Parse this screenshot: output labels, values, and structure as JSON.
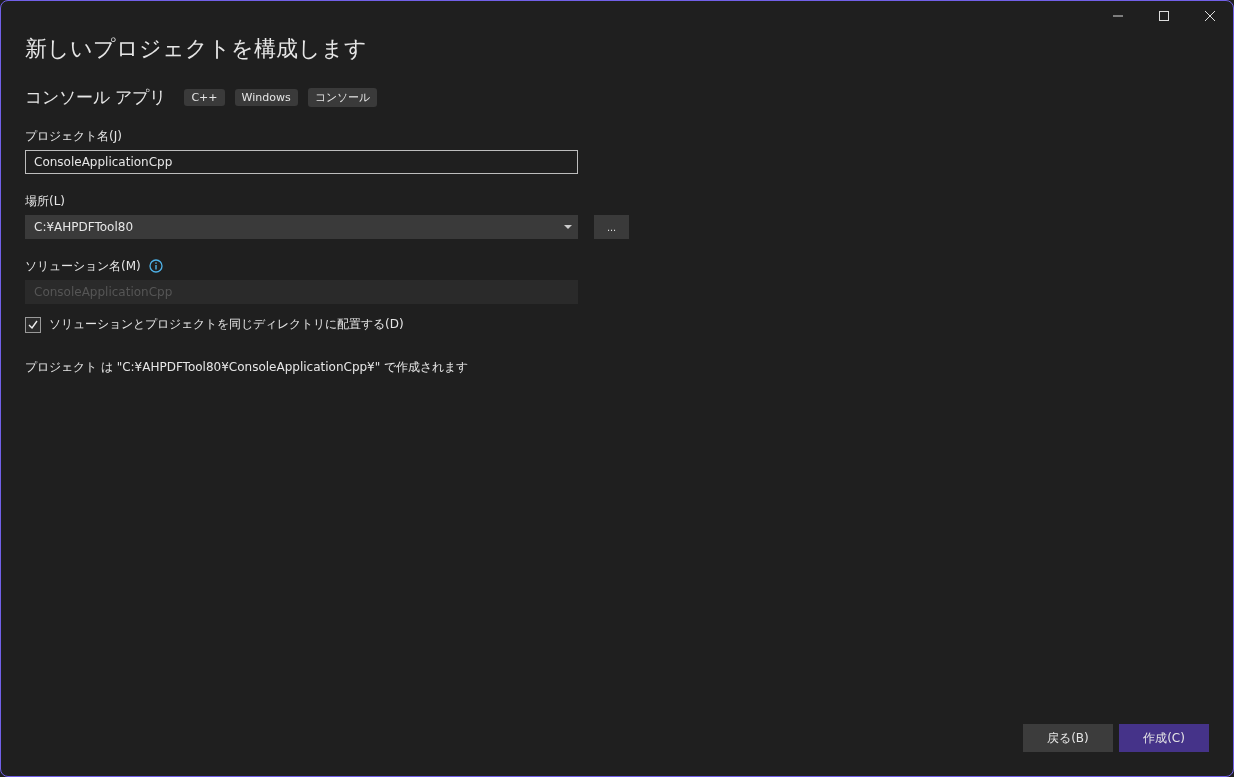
{
  "window": {
    "title": "新しいプロジェクトを構成します"
  },
  "template": {
    "name": "コンソール アプリ",
    "tags": [
      "C++",
      "Windows",
      "コンソール"
    ]
  },
  "fields": [
    {
      "kind": "text",
      "label": "プロジェクト名(J)",
      "value": "ConsoleApplicationCpp",
      "disabled": false,
      "info": false
    },
    {
      "kind": "combo",
      "label": "場所(L)",
      "value": "C:¥AHPDFTool80",
      "disabled": false,
      "info": false,
      "browse": "..."
    },
    {
      "kind": "text",
      "label": "ソリューション名(M)",
      "value": "ConsoleApplicationCpp",
      "disabled": true,
      "info": true
    }
  ],
  "same_directory": {
    "label": "ソリューションとプロジェクトを同じディレクトリに配置する(D)",
    "checked": true
  },
  "summary": "プロジェクト は \"C:¥AHPDFTool80¥ConsoleApplicationCpp¥\" で作成されます",
  "buttons": [
    {
      "label": "戻る(B)",
      "primary": false
    },
    {
      "label": "作成(C)",
      "primary": true
    }
  ]
}
